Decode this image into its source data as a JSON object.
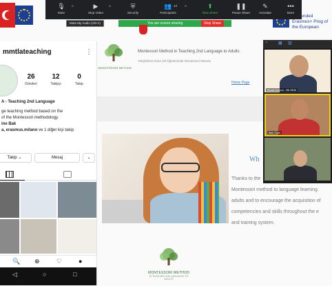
{
  "site": {
    "cofunded": "Co-funded Erasmus+ Prog of the European",
    "logo_text": "MONTESSORI METHOD",
    "title": "Montessori Method in Teaching 2nd Language to Adults",
    "subtitle": "Yetişkinlere İkinci Dil Öğretiminde Montessori Metodu",
    "nav_home": "Home Page",
    "nav_other": "",
    "welcome_heading": "Wh",
    "body_lines": [
      "Thanks to the",
      "Montessori method to language learning",
      "adults and to encourage the acquisition of",
      "competencies and skills throughout the e",
      "and training system."
    ],
    "footer_logo": "MONTESSORI METHOD",
    "footer_logo_sub": "IN TEACHING 2ND LANGUAGE TO ADULTS"
  },
  "zoom": {
    "toolbar": [
      {
        "label": "Mute",
        "icon": "microphone-icon"
      },
      {
        "label": "Stop Video",
        "icon": "video-camera-icon"
      },
      {
        "label": "Security",
        "icon": "shield-icon"
      },
      {
        "label": "Participants",
        "icon": "participants-icon"
      },
      {
        "label": "New Share",
        "icon": "share-screen-icon"
      },
      {
        "label": "Pause Share",
        "icon": "pause-icon"
      },
      {
        "label": "Annotate",
        "icon": "pencil-icon"
      },
      {
        "label": "More",
        "icon": "more-icon"
      }
    ],
    "participants_count": "14",
    "mute_tooltip": "Mute My Audio (Alt+A)",
    "sharing_text": "You are screen sharing",
    "stop_share": "Stop Share"
  },
  "instagram": {
    "username": "mmtlateaching",
    "stats": [
      {
        "num": "26",
        "label": "Gönderi"
      },
      {
        "num": "12",
        "label": "Takipçi"
      },
      {
        "num": "0",
        "label": "Takip"
      }
    ],
    "bio_name": "A - Teaching 2nd Language",
    "bio_lines": [
      "ge teaching method based on the",
      "of the Montessori methodology."
    ],
    "bio_link": "ine Bak",
    "followed_by_bold": "a, erasmus.milano",
    "followed_by_rest": " ve 1 diğer kişi takip",
    "follow_button": "Takip ⌄",
    "message_button": "Mesaj",
    "more_button": "⌄"
  },
  "gallery": {
    "participants": [
      {
        "name": "Murat Gokcul - BILSEM"
      },
      {
        "name": "Ilker Özer"
      },
      {
        "name": ""
      }
    ]
  },
  "colors": {
    "zoom_bar": "#202124",
    "zoom_green": "#3fbf5a",
    "stop_red": "#e0302b",
    "link_blue": "#3a7ab8",
    "eu_blue": "#1c3f94",
    "tr_red": "#d92323"
  }
}
